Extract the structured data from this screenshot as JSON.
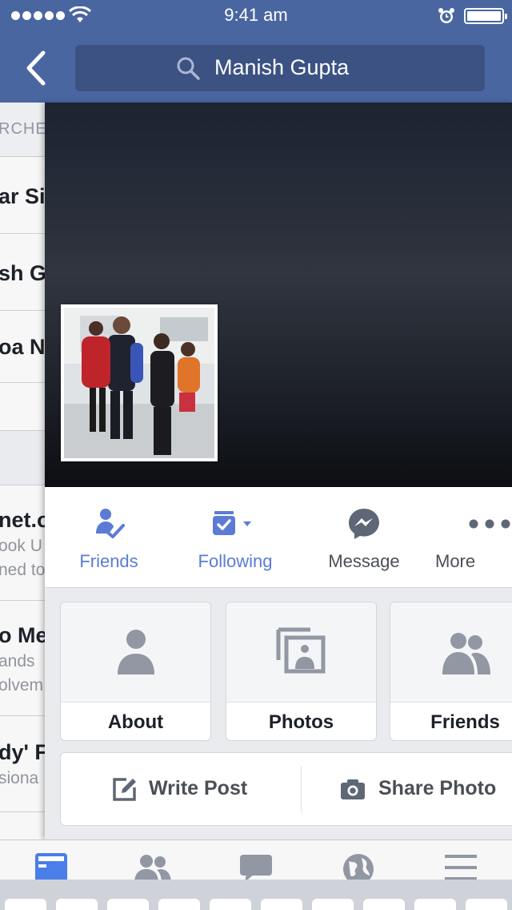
{
  "status_bar": {
    "time": "9:41 am"
  },
  "nav": {
    "search_value": "Manish Gupta"
  },
  "left_list": {
    "header": "RCHE",
    "rows": [
      {
        "t1": "ar Si"
      },
      {
        "t1": "sh G"
      },
      {
        "t1": "oa Na"
      },
      {
        "t1": "net.o",
        "t2": "ook U",
        "t3": "ned to"
      },
      {
        "t1": "o Me",
        "t2": "ands",
        "t3": "olvem"
      },
      {
        "t1": "dy' F",
        "t2": "siona"
      }
    ]
  },
  "profile_actions": [
    {
      "label": "Friends",
      "icon": "friends-check-icon",
      "active": true
    },
    {
      "label": "Following",
      "icon": "following-icon",
      "active": true
    },
    {
      "label": "Message",
      "icon": "messenger-icon",
      "active": false
    },
    {
      "label": "More",
      "icon": "more-dots-icon",
      "active": false
    }
  ],
  "profile_cards": [
    {
      "label": "About",
      "icon": "person-icon"
    },
    {
      "label": "Photos",
      "icon": "photos-icon"
    },
    {
      "label": "Friends",
      "icon": "friends-icon"
    }
  ],
  "composer": {
    "write_post": "Write Post",
    "share_photo": "Share Photo"
  },
  "tab_bar": [
    "news-feed-icon",
    "friend-requests-icon",
    "messages-icon",
    "notifications-globe-icon",
    "menu-icon"
  ],
  "colors": {
    "nav_blue": "#4a66a0",
    "search_bg": "#3b5283",
    "accent_blue": "#5b7bd5",
    "grey_text": "#4b4f56"
  }
}
